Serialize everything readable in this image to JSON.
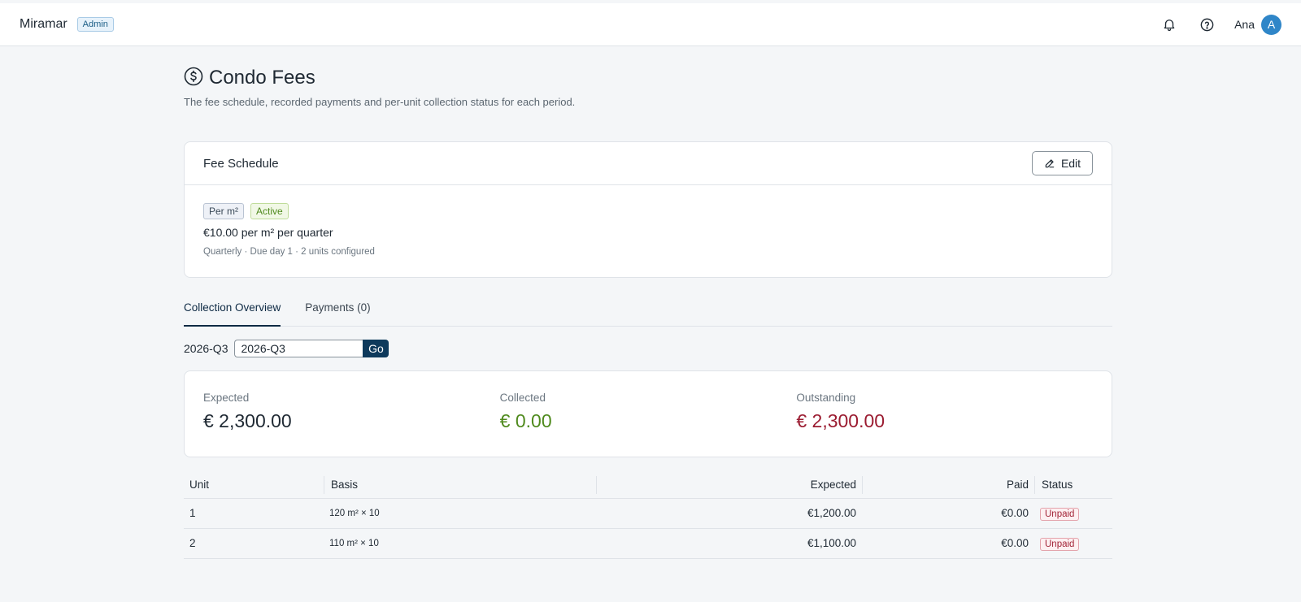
{
  "header": {
    "brand": "Miramar",
    "role_badge": "Admin",
    "user_name": "Ana",
    "avatar_initial": "A",
    "icons": [
      "bell-icon",
      "help-icon"
    ]
  },
  "page": {
    "title": "Condo Fees",
    "title_icon": "dollar-circle-icon",
    "subtitle": "The fee schedule, recorded payments and per-unit collection status for each period."
  },
  "fee_schedule": {
    "title": "Fee Schedule",
    "edit_label": "Edit",
    "tags": {
      "basis": "Per m²",
      "status": "Active"
    },
    "rate": "€10.00 per m² per quarter",
    "meta": "Quarterly · Due day 1 · 2 units configured"
  },
  "tabs": [
    {
      "label": "Collection Overview",
      "active": true
    },
    {
      "label": "Payments (0)",
      "active": false
    }
  ],
  "period": {
    "label": "2026-Q3",
    "input_value": "2026-Q3",
    "go_label": "Go"
  },
  "summary": {
    "expected_label": "Expected",
    "expected_value": "€ 2,300.00",
    "collected_label": "Collected",
    "collected_value": "€ 0.00",
    "outstanding_label": "Outstanding",
    "outstanding_value": "€ 2,300.00"
  },
  "table": {
    "headers": {
      "unit": "Unit",
      "basis": "Basis",
      "expected": "Expected",
      "paid": "Paid",
      "status": "Status"
    },
    "rows": [
      {
        "unit": "1",
        "basis": "120 m² × 10",
        "expected": "€1,200.00",
        "paid": "€0.00",
        "status": "Unpaid"
      },
      {
        "unit": "2",
        "basis": "110 m² × 10",
        "expected": "€1,100.00",
        "paid": "€0.00",
        "status": "Unpaid"
      }
    ]
  },
  "colors": {
    "accent": "#0e3a5c",
    "avatar": "#2f86c8",
    "collected": "#4f8a1d",
    "outstanding": "#9b1c31"
  }
}
